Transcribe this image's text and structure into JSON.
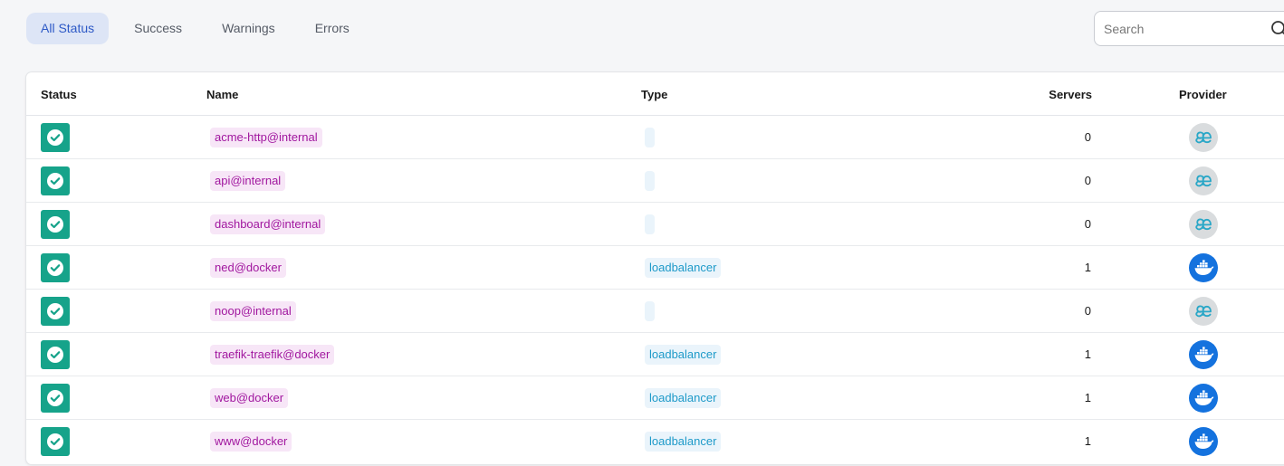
{
  "filters": [
    {
      "label": "All Status",
      "active": true
    },
    {
      "label": "Success",
      "active": false
    },
    {
      "label": "Warnings",
      "active": false
    },
    {
      "label": "Errors",
      "active": false
    }
  ],
  "search": {
    "placeholder": "Search",
    "value": ""
  },
  "table": {
    "headers": {
      "status": "Status",
      "name": "Name",
      "type": "Type",
      "servers": "Servers",
      "provider": "Provider"
    },
    "rows": [
      {
        "status": "success",
        "name": "acme-http@internal",
        "type": "",
        "servers": "0",
        "provider": "internal"
      },
      {
        "status": "success",
        "name": "api@internal",
        "type": "",
        "servers": "0",
        "provider": "internal"
      },
      {
        "status": "success",
        "name": "dashboard@internal",
        "type": "",
        "servers": "0",
        "provider": "internal"
      },
      {
        "status": "success",
        "name": "ned@docker",
        "type": "loadbalancer",
        "servers": "1",
        "provider": "docker"
      },
      {
        "status": "success",
        "name": "noop@internal",
        "type": "",
        "servers": "0",
        "provider": "internal"
      },
      {
        "status": "success",
        "name": "traefik-traefik@docker",
        "type": "loadbalancer",
        "servers": "1",
        "provider": "docker"
      },
      {
        "status": "success",
        "name": "web@docker",
        "type": "loadbalancer",
        "servers": "1",
        "provider": "docker"
      },
      {
        "status": "success",
        "name": "www@docker",
        "type": "loadbalancer",
        "servers": "1",
        "provider": "docker"
      }
    ]
  },
  "icons": {
    "status_success": "check-circle-icon",
    "provider_internal": "traefik-internal-icon",
    "provider_docker": "docker-whale-icon",
    "search": "search-icon"
  },
  "colors": {
    "success": "#16a38a",
    "name_chip_bg": "#f7e6f7",
    "name_chip_text": "#a1179f",
    "type_chip_bg": "#eaf4fb",
    "type_chip_text": "#1e9ac9",
    "active_tab_bg": "#dde5f6",
    "active_tab_text": "#2d59c6",
    "docker": "#1472de",
    "internal": "#d9dcde"
  }
}
